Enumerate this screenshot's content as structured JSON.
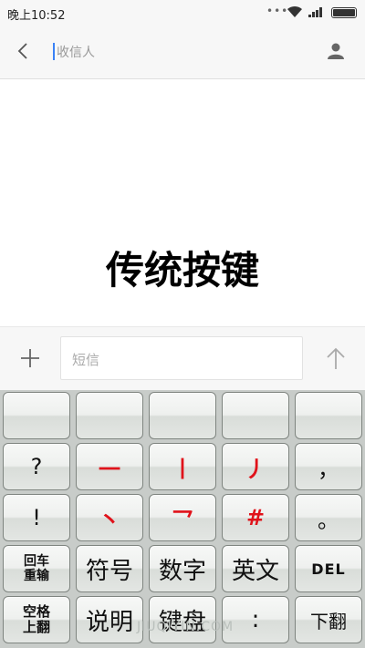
{
  "status_bar": {
    "time": "晚上10:52",
    "dots": "•••"
  },
  "header": {
    "recipient_placeholder": "收信人"
  },
  "overlay_title": "传统按键",
  "compose": {
    "sms_placeholder": "短信"
  },
  "keyboard": {
    "row1": [
      "",
      "",
      "",
      "",
      ""
    ],
    "row2": [
      "?",
      "一",
      "丨",
      "丿",
      "，"
    ],
    "row3": [
      "!",
      "丶",
      "乛",
      "#",
      "。"
    ],
    "row4": {
      "enter_line1": "回车",
      "enter_line2": "重输",
      "symbols": "符号",
      "digits": "数字",
      "english": "英文",
      "del": "DEL"
    },
    "row5": {
      "space_line1": "空格",
      "space_line2": "上翻",
      "help": "说明",
      "keypad": "键盘",
      "colon": ":",
      "page_down": "下翻"
    },
    "accent_color": "#e0121a"
  },
  "watermark": "JIUQIYIN.COM"
}
